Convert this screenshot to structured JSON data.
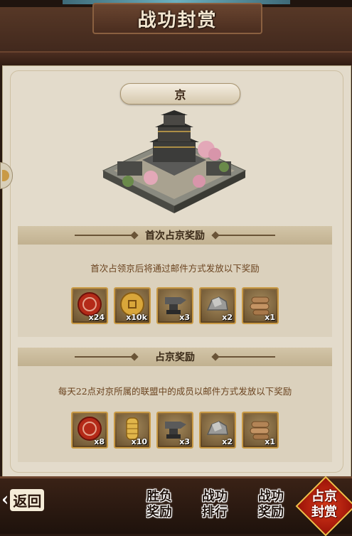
{
  "header": {
    "title": "战功封赏"
  },
  "city": {
    "name": "京"
  },
  "first_occupy": {
    "heading": "首次占京奖励",
    "description": "首次占领京后将通过邮件方式发放以下奖励",
    "rewards": [
      {
        "icon": "red-seal-icon",
        "count": "x24"
      },
      {
        "icon": "gold-coin-icon",
        "count": "x10k"
      },
      {
        "icon": "iron-anvil-icon",
        "count": "x3"
      },
      {
        "icon": "stone-icon",
        "count": "x2"
      },
      {
        "icon": "wood-log-icon",
        "count": "x1"
      }
    ]
  },
  "daily_occupy": {
    "heading": "占京奖励",
    "description": "每天22点对京所属的联盟中的成员以邮件方式发放以下奖励",
    "rewards": [
      {
        "icon": "red-seal-icon",
        "count": "x8"
      },
      {
        "icon": "gold-scroll-icon",
        "count": "x10"
      },
      {
        "icon": "iron-anvil-icon",
        "count": "x3"
      },
      {
        "icon": "stone-icon",
        "count": "x2"
      },
      {
        "icon": "wood-log-icon",
        "count": "x1"
      }
    ]
  },
  "nav": {
    "back": "返回",
    "tabs": [
      {
        "line1": "胜负",
        "line2": "奖励"
      },
      {
        "line1": "战功",
        "line2": "排行"
      },
      {
        "line1": "战功",
        "line2": "奖励"
      },
      {
        "line1": "占京",
        "line2": "封赏"
      }
    ]
  },
  "colors": {
    "accent_red": "#c8290f",
    "gold_border": "#c99a45",
    "panel_bg": "#e3dbcb"
  }
}
